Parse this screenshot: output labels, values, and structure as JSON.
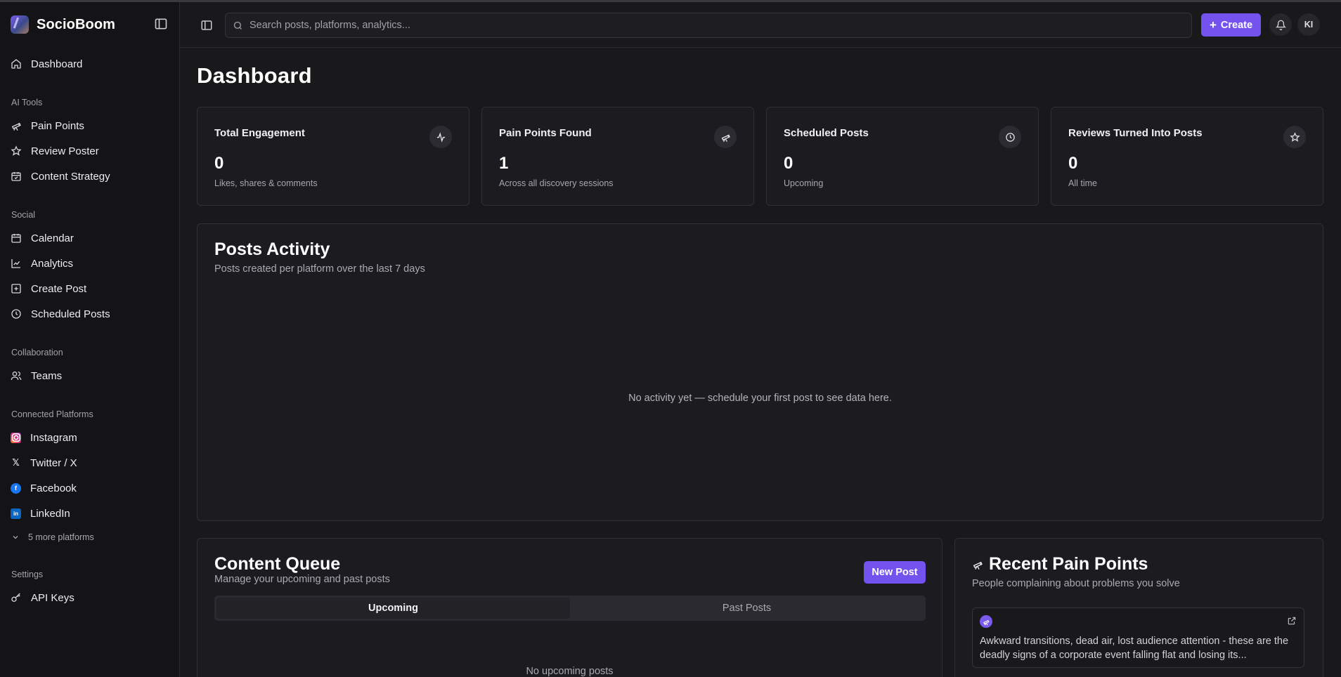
{
  "app": {
    "name": "SocioBoom"
  },
  "sidebar": {
    "dashboard": "Dashboard",
    "sections": {
      "ai_tools": "AI Tools",
      "social": "Social",
      "collaboration": "Collaboration",
      "connected_platforms": "Connected Platforms",
      "settings": "Settings"
    },
    "ai_tools": [
      "Pain Points",
      "Review Poster",
      "Content Strategy"
    ],
    "social": [
      "Calendar",
      "Analytics",
      "Create Post",
      "Scheduled Posts"
    ],
    "collaboration": [
      "Teams"
    ],
    "platforms": [
      "Instagram",
      "Twitter / X",
      "Facebook",
      "LinkedIn"
    ],
    "more_platforms": "5 more platforms",
    "settings": [
      "API Keys"
    ]
  },
  "topbar": {
    "search_placeholder": "Search posts, platforms, analytics...",
    "create_label": "Create",
    "avatar_initials": "KI"
  },
  "page": {
    "title": "Dashboard"
  },
  "stats": [
    {
      "title": "Total Engagement",
      "value": "0",
      "sub": "Likes, shares & comments",
      "icon": "activity-icon"
    },
    {
      "title": "Pain Points Found",
      "value": "1",
      "sub": "Across all discovery sessions",
      "icon": "telescope-icon"
    },
    {
      "title": "Scheduled Posts",
      "value": "0",
      "sub": "Upcoming",
      "icon": "clock-icon"
    },
    {
      "title": "Reviews Turned Into Posts",
      "value": "0",
      "sub": "All time",
      "icon": "star-icon"
    }
  ],
  "posts_activity": {
    "title": "Posts Activity",
    "subtitle": "Posts created per platform over the last 7 days",
    "empty": "No activity yet — schedule your first post to see data here."
  },
  "content_queue": {
    "title": "Content Queue",
    "subtitle": "Manage your upcoming and past posts",
    "new_post": "New Post",
    "tabs": [
      "Upcoming",
      "Past Posts"
    ],
    "empty": "No upcoming posts"
  },
  "recent_pain_points": {
    "title": "Recent Pain Points",
    "subtitle": "People complaining about problems you solve",
    "items": [
      {
        "text": "Awkward transitions, dead air, lost audience attention - these are the deadly signs of a corporate event falling flat and losing its..."
      }
    ]
  },
  "colors": {
    "accent": "#7452ee",
    "background": "#19191c",
    "sidebar": "#141417",
    "instagram": "#e1306c",
    "facebook": "#1877f2",
    "linkedin": "#0a66c2"
  }
}
